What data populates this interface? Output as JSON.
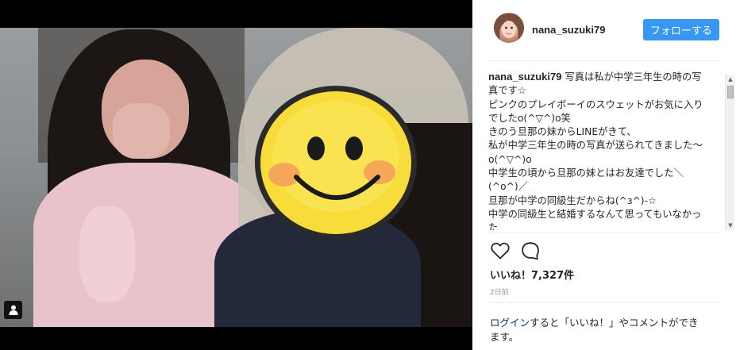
{
  "post": {
    "username": "nana_suzuki79",
    "follow_label": "フォローする",
    "caption_text": "写真は私が中学三年生の時の写真です☆\nピンクのプレイボーイのスウェットがお気に入りでしたo(^▽^)o笑\nきのう旦那の妹からLINEがきて、\n私が中学三年生の時の写真が送られてきました〜o(^▽^)o\n中学生の頃から旦那の妹とはお友達でした＼(^o^)／\n旦那が中学の同級生だからね(^з^)-☆\n中学の同級生と結婚するなんて思ってもいなかった",
    "likes": "いいね！7,327件",
    "time": "2日前"
  },
  "login": {
    "link": "ログイン",
    "text": "すると「いいね！」やコメントができます。"
  },
  "icons": {
    "like": "heart-outline-icon",
    "comment": "comment-bubble-icon",
    "tagged_users": "person-icon"
  },
  "colors": {
    "follow_button": "#3897f0",
    "text": "#262626",
    "muted": "#999999",
    "link": "#003569"
  }
}
